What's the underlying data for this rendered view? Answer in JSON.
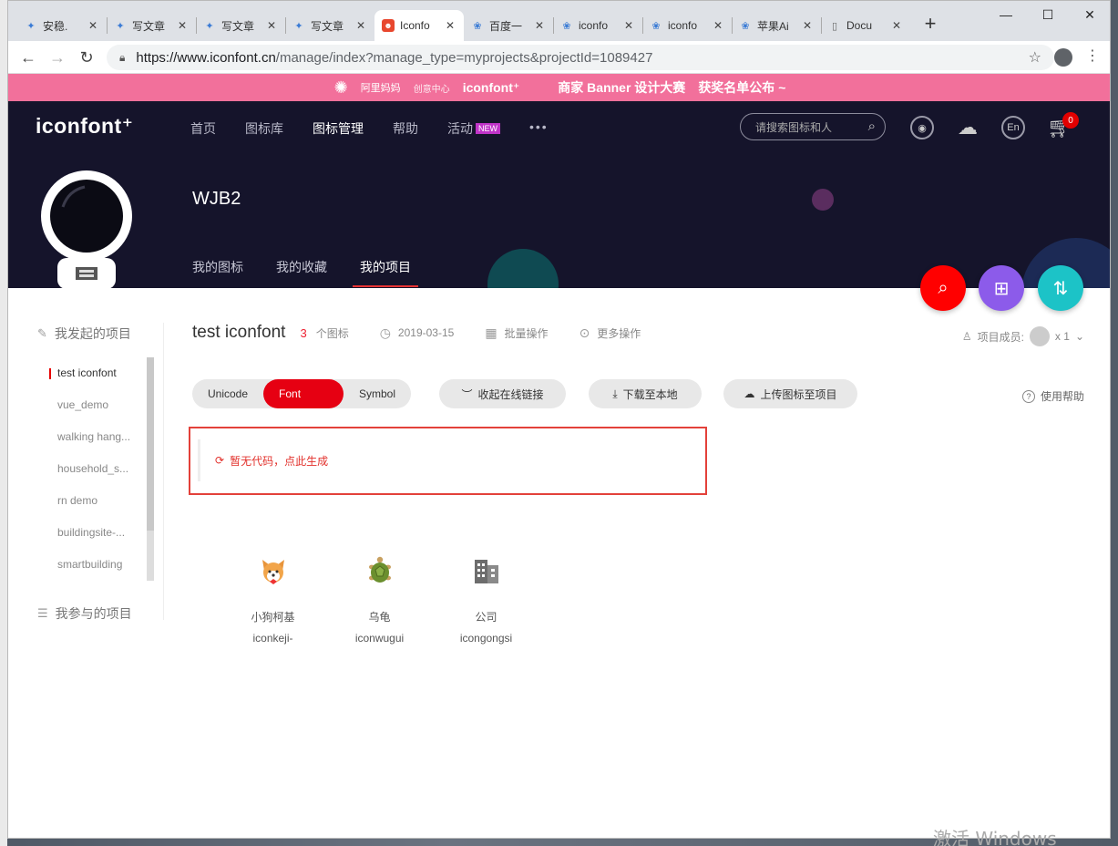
{
  "browser": {
    "tabs": [
      {
        "title": "安稳.",
        "icon": "paw-icon",
        "active": false
      },
      {
        "title": "写文章",
        "icon": "paw-icon",
        "active": false
      },
      {
        "title": "写文章",
        "icon": "paw-icon",
        "active": false
      },
      {
        "title": "写文章",
        "icon": "paw-icon",
        "active": false
      },
      {
        "title": "Iconfo",
        "icon": "iconfont-favicon",
        "active": true
      },
      {
        "title": "百度一",
        "icon": "baidu-paw-icon",
        "active": false
      },
      {
        "title": "iconfo",
        "icon": "baidu-paw-icon",
        "active": false
      },
      {
        "title": "iconfo",
        "icon": "baidu-paw-icon",
        "active": false
      },
      {
        "title": "苹果Ai",
        "icon": "baidu-paw-icon",
        "active": false
      },
      {
        "title": "Docu",
        "icon": "document-icon",
        "active": false
      }
    ],
    "url_host": "https://www.iconfont.cn",
    "url_path": "/manage/index?manage_type=myprojects&projectId=1089427"
  },
  "banner": {
    "brand": "阿里妈妈",
    "brand_sub": "创意中心",
    "logo": "iconfont⁺",
    "headline": "商家 Banner 设计大赛",
    "cta": "获奖名单公布 ~"
  },
  "header": {
    "logo": "iconfont⁺",
    "nav": [
      {
        "label": "首页",
        "active": false
      },
      {
        "label": "图标库",
        "active": false
      },
      {
        "label": "图标管理",
        "active": true
      },
      {
        "label": "帮助",
        "active": false
      },
      {
        "label": "活动",
        "active": false
      }
    ],
    "new_badge": "NEW",
    "more": "•••",
    "search_placeholder": "请搜索图标和人",
    "lang": "En",
    "cart_count": "0",
    "username": "WJB2",
    "subnav": [
      {
        "label": "我的图标",
        "active": false
      },
      {
        "label": "我的收藏",
        "active": false
      },
      {
        "label": "我的项目",
        "active": true
      }
    ]
  },
  "sidebar": {
    "created_heading": "我发起的项目",
    "projects": [
      {
        "label": "test iconfont",
        "active": true
      },
      {
        "label": "vue_demo",
        "active": false
      },
      {
        "label": "walking hang...",
        "active": false
      },
      {
        "label": "household_s...",
        "active": false
      },
      {
        "label": "rn demo",
        "active": false
      },
      {
        "label": "buildingsite-...",
        "active": false
      },
      {
        "label": "smartbuilding",
        "active": false
      }
    ],
    "joined_heading": "我参与的项目"
  },
  "project": {
    "title": "test iconfont",
    "count": "3",
    "count_label": "个图标",
    "date": "2019-03-15",
    "batch": "批量操作",
    "more": "更多操作",
    "members_label": "项目成员:",
    "members_count": "x 1"
  },
  "toolbar": {
    "segments": [
      {
        "label": "Unicode",
        "active": false
      },
      {
        "label": "Font class",
        "active": true
      },
      {
        "label": "Symbol",
        "active": false
      }
    ],
    "collapse_link": "收起在线链接",
    "download": "下载至本地",
    "upload": "上传图标至项目",
    "help": "使用帮助"
  },
  "code": {
    "empty_text": "暂无代码，点此生成"
  },
  "icons": [
    {
      "name": "小狗柯基",
      "code": "iconkeji-",
      "glyph": "corgi-icon"
    },
    {
      "name": "乌龟",
      "code": "iconwugui",
      "glyph": "turtle-icon"
    },
    {
      "name": "公司",
      "code": "icongongsi",
      "glyph": "company-building-icon"
    }
  ],
  "watermark": "激活 Windows",
  "colors": {
    "accent": "#e60012",
    "header_bg": "#15142b",
    "banner_bg": "#f2709b",
    "fab_search": "#ff0000",
    "fab_folder": "#8c5bea",
    "fab_sort": "#1cc3c7"
  }
}
